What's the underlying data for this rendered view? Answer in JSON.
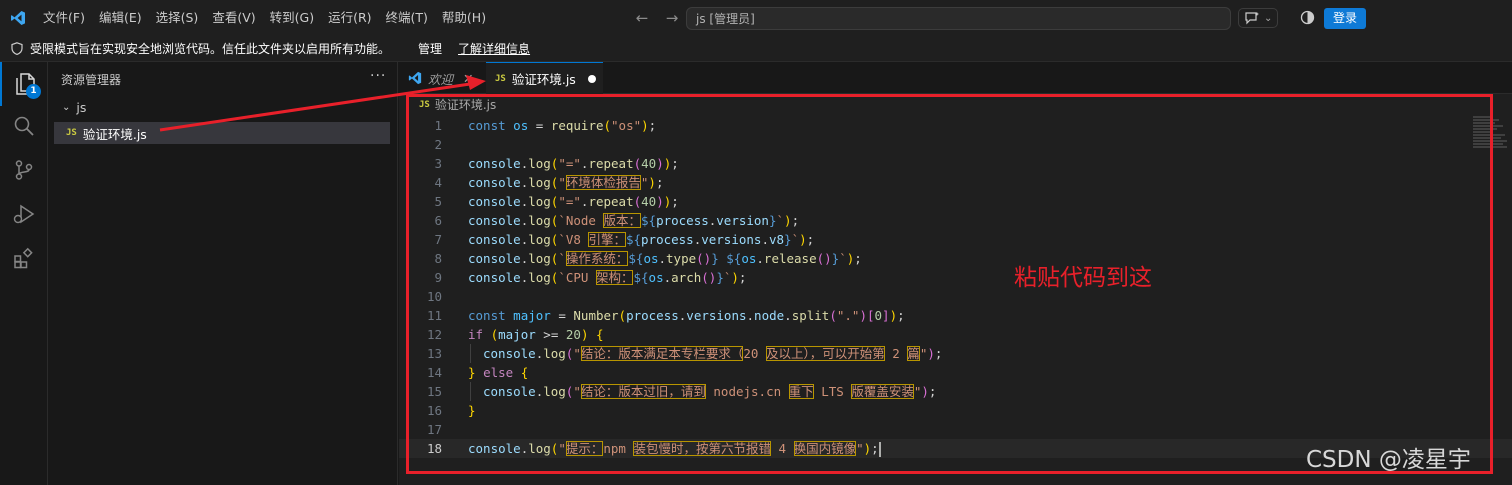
{
  "titlebar": {
    "menu": [
      "文件(F)",
      "编辑(E)",
      "选择(S)",
      "查看(V)",
      "转到(G)",
      "运行(R)",
      "终端(T)",
      "帮助(H)"
    ],
    "search_text": "js [管理员]",
    "login_label": "登录"
  },
  "banner": {
    "message": "受限模式旨在实现安全地浏览代码。信任此文件夹以启用所有功能。",
    "manage_label": "管理",
    "learn_label": "了解详细信息"
  },
  "activitybar": {
    "explorer_badge": "1"
  },
  "sidebar": {
    "title": "资源管理器",
    "more": "···",
    "folder": "js",
    "file": "验证环境.js",
    "file_icon": "JS"
  },
  "tabs": [
    {
      "label": "欢迎",
      "close": "✕"
    },
    {
      "label": "验证环境.js",
      "icon": "JS"
    }
  ],
  "breadcrumb": {
    "icon": "JS",
    "file": "验证环境.js"
  },
  "editor": {
    "current_line": 18,
    "line_numbers": [
      "1",
      "2",
      "3",
      "4",
      "5",
      "6",
      "7",
      "8",
      "9",
      "10",
      "11",
      "12",
      "13",
      "14",
      "15",
      "16",
      "17",
      "18"
    ]
  },
  "annotation": {
    "label": "粘贴代码到这",
    "watermark": "CSDN @凌星宇",
    "color": "#e8202a"
  }
}
